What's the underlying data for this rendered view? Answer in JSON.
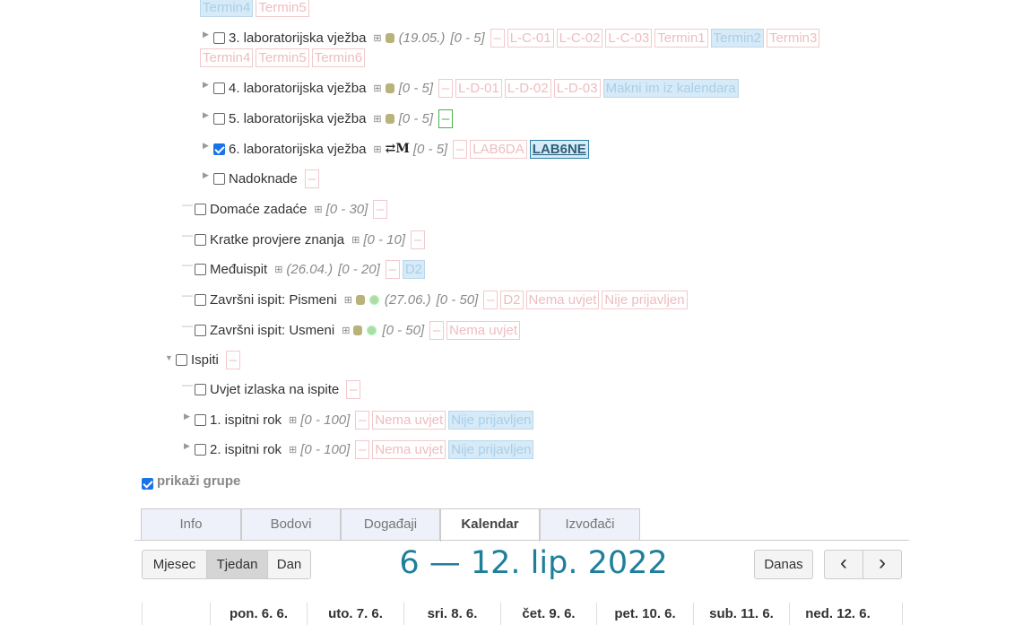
{
  "top_tags": [
    "Termin4",
    "Termin5"
  ],
  "lab3": {
    "label": "3. laboratorijska vježba",
    "date": "(19.05.)",
    "range": "[0 - 5]",
    "tags": [
      "L-C-01",
      "L-C-02",
      "L-C-03",
      "Termin1",
      "Termin2",
      "Termin3"
    ],
    "tags2": [
      "Termin4",
      "Termin5",
      "Termin6"
    ]
  },
  "lab4": {
    "label": "4. laboratorijska vježba",
    "range": "[0 - 5]",
    "tags": [
      "L-D-01",
      "L-D-02",
      "L-D-03"
    ],
    "remove": "Makni im iz kalendara"
  },
  "lab5": {
    "label": "5. laboratorijska vježba",
    "range": "[0 - 5]"
  },
  "lab6": {
    "label": "6. laboratorijska vježba",
    "icon_m": "⇄M",
    "range": "[0 - 5]",
    "tag1": "LAB6DA",
    "tag2": "LAB6NE"
  },
  "nadoknade": {
    "label": "Nadoknade"
  },
  "domace": {
    "label": "Domaće zadaće",
    "range": "[0 - 30]"
  },
  "kratke": {
    "label": "Kratke provjere znanja",
    "range": "[0 - 10]"
  },
  "medju": {
    "label": "Međuispit",
    "date": "(26.04.)",
    "range": "[0 - 20]",
    "tag": "D2"
  },
  "zav_pis": {
    "label": "Završni ispit: Pismeni",
    "date": "(27.06.)",
    "range": "[0 - 50]",
    "tags": [
      "D2",
      "Nema uvjet",
      "Nije prijavljen"
    ]
  },
  "zav_usm": {
    "label": "Završni ispit: Usmeni",
    "range": "[0 - 50]",
    "tag": "Nema uvjet"
  },
  "ispiti": {
    "label": "Ispiti"
  },
  "uvjet": {
    "label": "Uvjet izlaska na ispite"
  },
  "rok1": {
    "label": "1. ispitni rok",
    "range": "[0 - 100]",
    "tag1": "Nema uvjet",
    "tag2": "Nije prijavljen"
  },
  "rok2": {
    "label": "2. ispitni rok",
    "range": "[0 - 100]",
    "tag1": "Nema uvjet",
    "tag2": "Nije prijavljen"
  },
  "dash": "–",
  "show_groups": "prikaži grupe",
  "tabs": [
    "Info",
    "Bodovi",
    "Događaji",
    "Kalendar",
    "Izvođači"
  ],
  "view_buttons": [
    "Mjesec",
    "Tjedan",
    "Dan"
  ],
  "cal_title": "6 — 12. lip. 2022",
  "today": "Danas",
  "prev": "‹",
  "next": "›",
  "days": [
    "pon. 6. 6.",
    "uto. 7. 6.",
    "sri. 8. 6.",
    "čet. 9. 6.",
    "pet. 10. 6.",
    "sub. 11. 6.",
    "ned. 12. 6."
  ],
  "colors": {
    "accent": "#1e7f9b",
    "tag_border": "#f2c9cc",
    "tag_blue": "#d6eaf8",
    "green": "#4caf50"
  }
}
